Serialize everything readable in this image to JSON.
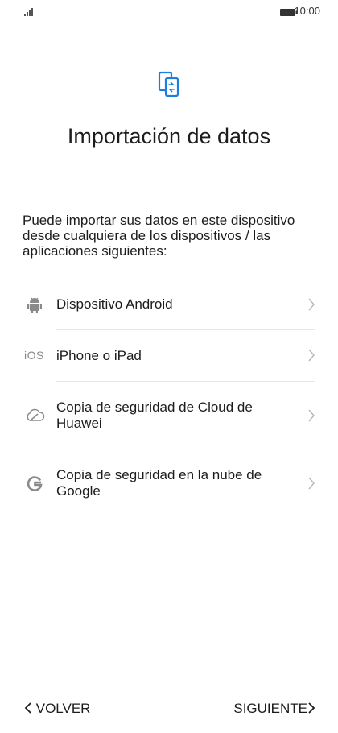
{
  "status_bar": {
    "time": "10:00",
    "icons": [
      "signal-icon",
      "battery-icon"
    ]
  },
  "header": {
    "app_icon": "phone-transfer-icon",
    "title": "Importación de datos"
  },
  "description": "Puede importar sus datos en este dispositivo desde cualquiera de los dispositivos / las aplicaciones siguientes:",
  "options": [
    {
      "icon": "android-icon",
      "label": "Dispositivo Android"
    },
    {
      "icon": "ios-icon",
      "icon_text": "iOS",
      "label": "iPhone o iPad"
    },
    {
      "icon": "cloud-icon",
      "label": "Copia de seguridad de Cloud de Huawei"
    },
    {
      "icon": "google-icon",
      "label": "Copia de seguridad en la nube de Google"
    }
  ],
  "footer": {
    "back_label": "VOLVER",
    "next_label": "SIGUIENTE"
  },
  "colors": {
    "accent": "#1a7de0",
    "text": "#1c1c1c",
    "icon_gray": "#8a8a8a",
    "divider": "#e6e6e6"
  }
}
